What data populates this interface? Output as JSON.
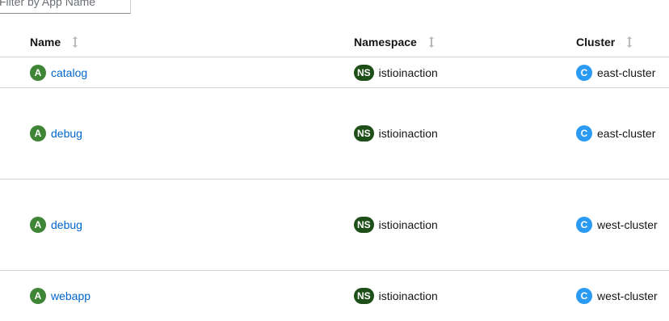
{
  "filter": {
    "placeholder": "Filter by App Name"
  },
  "table": {
    "headers": {
      "name": "Name",
      "namespace": "Namespace",
      "cluster": "Cluster"
    },
    "rows": [
      {
        "app_badge": "A",
        "name": "catalog",
        "ns_badge": "NS",
        "namespace": "istioinaction",
        "cluster_badge": "C",
        "cluster": "east-cluster"
      },
      {
        "app_badge": "A",
        "name": "debug",
        "ns_badge": "NS",
        "namespace": "istioinaction",
        "cluster_badge": "C",
        "cluster": "east-cluster"
      },
      {
        "app_badge": "A",
        "name": "debug",
        "ns_badge": "NS",
        "namespace": "istioinaction",
        "cluster_badge": "C",
        "cluster": "west-cluster"
      },
      {
        "app_badge": "A",
        "name": "webapp",
        "ns_badge": "NS",
        "namespace": "istioinaction",
        "cluster_badge": "C",
        "cluster": "west-cluster"
      }
    ]
  },
  "colors": {
    "app_badge": "#3e8635",
    "ns_badge": "#1e4f18",
    "cluster_badge": "#2b9af3",
    "link": "#0066cc"
  },
  "icons": {
    "sort": "sort-icon"
  }
}
